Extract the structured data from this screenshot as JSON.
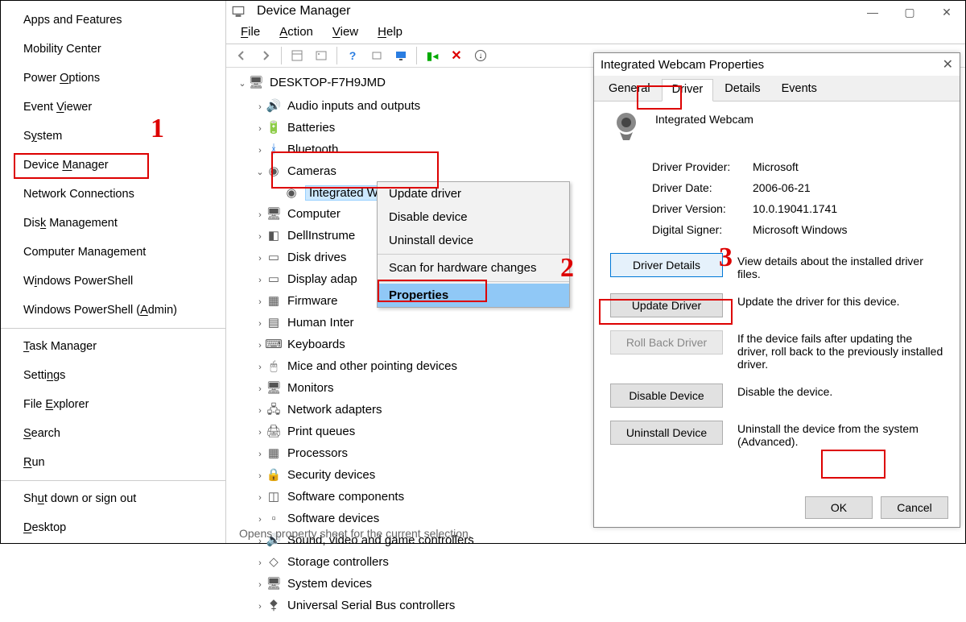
{
  "winx": {
    "items": [
      "Apps and Features",
      "Mobility Center",
      "Power Options",
      "Event Viewer",
      "System",
      "Device Manager",
      "Network Connections",
      "Disk Management",
      "Computer Management",
      "Windows PowerShell",
      "Windows PowerShell (Admin)"
    ],
    "items2": [
      "Task Manager",
      "Settings",
      "File Explorer",
      "Search",
      "Run"
    ],
    "items3": [
      "Shut down or sign out",
      "Desktop"
    ]
  },
  "annotations": {
    "one": "1",
    "two": "2",
    "three": "3"
  },
  "dm": {
    "title": "Device Manager",
    "menu": {
      "file": "File",
      "action": "Action",
      "view": "View",
      "help": "Help"
    },
    "root": "DESKTOP-F7H9JMD",
    "nodes": [
      "Audio inputs and outputs",
      "Batteries",
      "Bluetooth",
      "Cameras",
      "Computer",
      "DellInstrume",
      "Disk drives",
      "Display adap",
      "Firmware",
      "Human Inter",
      "Keyboards",
      "Mice and other pointing devices",
      "Monitors",
      "Network adapters",
      "Print queues",
      "Processors",
      "Security devices",
      "Software components",
      "Software devices",
      "Sound, video and game controllers",
      "Storage controllers",
      "System devices",
      "Universal Serial Bus controllers"
    ],
    "cam_child": "Integrated Webcam",
    "ctx": {
      "update": "Update driver",
      "disable": "Disable device",
      "uninstall": "Uninstall device",
      "scan": "Scan for hardware changes",
      "props": "Properties"
    },
    "status": "Opens property sheet for the current selection."
  },
  "props": {
    "title": "Integrated Webcam Properties",
    "tabs": {
      "general": "General",
      "driver": "Driver",
      "details": "Details",
      "events": "Events"
    },
    "device_name": "Integrated Webcam",
    "info": {
      "provider_lbl": "Driver Provider:",
      "provider": "Microsoft",
      "date_lbl": "Driver Date:",
      "date": "2006-06-21",
      "ver_lbl": "Driver Version:",
      "ver": "10.0.19041.1741",
      "signer_lbl": "Digital Signer:",
      "signer": "Microsoft Windows"
    },
    "btns": {
      "details": "Driver Details",
      "details_desc": "View details about the installed driver files.",
      "update": "Update Driver",
      "update_desc": "Update the driver for this device.",
      "rollback": "Roll Back Driver",
      "rollback_desc": "If the device fails after updating the driver, roll back to the previously installed driver.",
      "disable": "Disable Device",
      "disable_desc": "Disable the device.",
      "uninstall": "Uninstall Device",
      "uninstall_desc": "Uninstall the device from the system (Advanced)."
    },
    "ok": "OK",
    "cancel": "Cancel"
  }
}
